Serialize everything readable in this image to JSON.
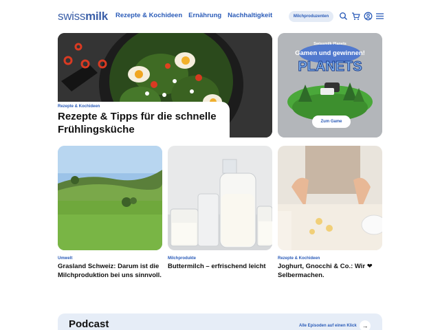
{
  "header": {
    "logo_part1": "swiss",
    "logo_part2": "milk",
    "nav": [
      "Rezepte & Kochideen",
      "Ernährung",
      "Nachhaltigkeit"
    ],
    "pill_label": "Milchproduzenten",
    "icons": [
      "search-icon",
      "cart-icon",
      "user-icon",
      "menu-icon"
    ]
  },
  "hero": {
    "tag": "Rezepte & Kochideen",
    "title": "Rezepte & Tipps für die schnelle Frühlingsküche"
  },
  "promo": {
    "subtitle": "Swissmilk Planets",
    "headline": "Gamen und gewinnen!",
    "logo_text": "swissmilk",
    "logo_text2": "PLANETS",
    "button": "Zum Game"
  },
  "cards": [
    {
      "tag": "Umwelt",
      "title": "Grasland Schweiz: Darum ist die Milchproduktion bei uns sinnvoll."
    },
    {
      "tag": "Milchprodukte",
      "title": "Buttermilch – erfrischend leicht"
    },
    {
      "tag": "Rezepte & Kochideen",
      "title": "Joghurt, Gnocchi & Co.: Wir ❤ Selbermachen."
    }
  ],
  "podcast": {
    "title": "Podcast",
    "link": "Alle Episoden auf einen Klick",
    "arrow": "→"
  },
  "colors": {
    "brand_blue": "#2a5bb8",
    "pill_bg": "#e4ebf6",
    "podcast_bg": "#e6edf7"
  }
}
